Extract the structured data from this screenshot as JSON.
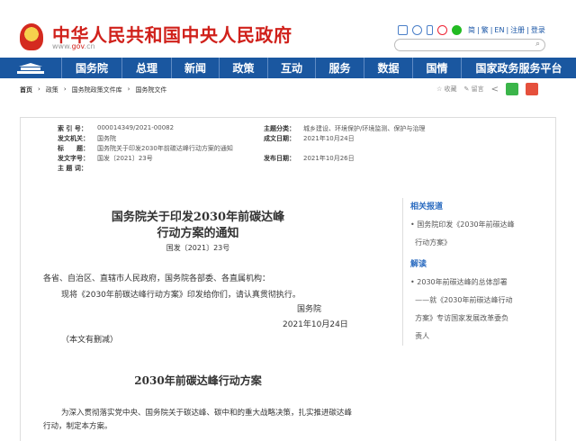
{
  "header": {
    "site_title": "中华人民共和国中央人民政府",
    "url_prefix": "www.",
    "url_gov": "gov",
    "url_suffix": ".cn",
    "links": [
      "简",
      "繁",
      "EN",
      "注册",
      "登录"
    ],
    "search_placeholder": ""
  },
  "nav": {
    "items": [
      "国务院",
      "总理",
      "新闻",
      "政策",
      "互动",
      "服务",
      "数据",
      "国情",
      "国家政务服务平台"
    ]
  },
  "breadcrumb": [
    "首页",
    "政策",
    "国务院政策文件库",
    "国务院文件"
  ],
  "tools": {
    "favorite": "收藏",
    "comment": "留言"
  },
  "meta": {
    "index_label": "索 引 号：",
    "index": "000014349/2021-00082",
    "category_label": "主题分类：",
    "category": "城乡建设、环境保护/环境监测、保护与治理",
    "issuer_label": "发文机关：",
    "issuer": "国务院",
    "written_label": "成文日期：",
    "written": "2021年10月24日",
    "title_label": "标　　题：",
    "title": "国务院关于印发2030年前碳达峰行动方案的通知",
    "docno_label": "发文字号：",
    "docno": "国发〔2021〕23号",
    "published_label": "发布日期：",
    "published": "2021年10月26日",
    "keywords_label": "主 题 词：",
    "keywords": ""
  },
  "sidebar": {
    "related_heading": "相关报道",
    "related": [
      "国务院印发《2030年前碳达峰",
      "行动方案》"
    ],
    "interpret_heading": "解读",
    "interpret": [
      "2030年前碳达峰的总体部署",
      "——就《2030年前碳达峰行动",
      "方案》专访国家发展改革委负",
      "责人"
    ]
  },
  "doc": {
    "title_line1": "国务院关于印发2030年前碳达峰",
    "title_line2": "行动方案的通知",
    "number": "国发〔2021〕23号",
    "salutation": "各省、自治区、直辖市人民政府，国务院各部委、各直属机构：",
    "body": "现将《2030年前碳达峰行动方案》印发给你们，请认真贯彻执行。",
    "signer": "国务院",
    "date": "2021年10月24日",
    "note": "（本文有删减）",
    "section_title": "2030年前碳达峰行动方案",
    "para1": "为深入贯彻落实党中央、国务院关于碳达峰、碳中和的重大战略决策，扎实推进碳达峰",
    "para2": "行动，制定本方案。"
  }
}
